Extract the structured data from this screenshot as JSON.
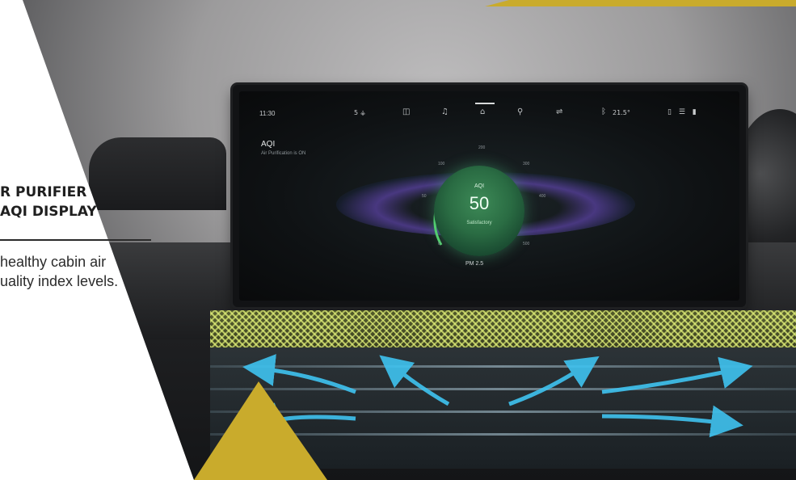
{
  "colors": {
    "accent_gold": "#c9ab2c",
    "panel_white": "#ffffff",
    "gauge_green": "#3d8a57",
    "airflow_cyan": "#3fc3f0",
    "ambient_yellow": "#d9e873"
  },
  "panel": {
    "heading_line1": "R PURIFIER",
    "heading_line2": "AQI DISPLAY",
    "desc_line1": "healthy cabin air",
    "desc_line2": "uality index levels."
  },
  "screen": {
    "time": "11:30",
    "fan": "5 ⚶",
    "temperature": "21.5°",
    "aqi_title": "AQI",
    "aqi_subtitle": "Air Purification is ON",
    "gauge": {
      "label": "AQI",
      "value": "50",
      "status": "Satisfactory",
      "ticks": [
        "0",
        "50",
        "100",
        "200",
        "300",
        "400",
        "500"
      ]
    },
    "pm_label": "PM 2.5"
  },
  "icons": [
    "fan-icon",
    "vent-icon",
    "bell-icon",
    "home-icon",
    "search-icon",
    "seat-icon",
    "bluetooth-icon",
    "phone-icon",
    "wifi-icon",
    "signal-icon",
    "battery-icon"
  ]
}
